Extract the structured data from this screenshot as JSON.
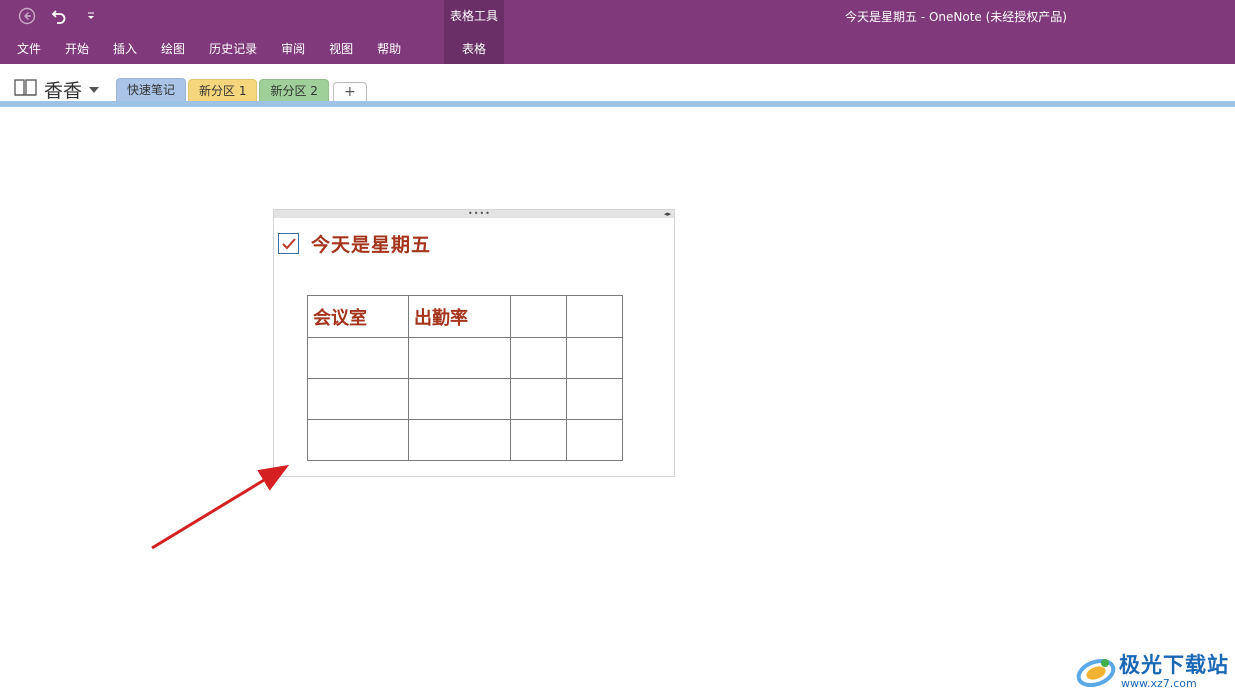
{
  "window": {
    "title": "今天是星期五  -  OneNote (未经授权产品)",
    "context_tab_group": "表格工具"
  },
  "quick_access": {
    "back_icon": "back-arrow-icon",
    "undo_icon": "undo-icon",
    "customize_icon": "customize-qat-icon"
  },
  "menu": {
    "items": [
      {
        "label": "文件"
      },
      {
        "label": "开始"
      },
      {
        "label": "插入"
      },
      {
        "label": "绘图"
      },
      {
        "label": "历史记录"
      },
      {
        "label": "审阅"
      },
      {
        "label": "视图"
      },
      {
        "label": "帮助"
      }
    ],
    "context_item": {
      "label": "表格"
    }
  },
  "notebook": {
    "name": "香香",
    "icon": "notebook-icon"
  },
  "sections": [
    {
      "label": "快速笔记",
      "color": "#a9c4e6",
      "active": true
    },
    {
      "label": "新分区 1",
      "color": "#f5d67c",
      "active": false
    },
    {
      "label": "新分区 2",
      "color": "#9fd09a",
      "active": false
    }
  ],
  "add_section_label": "+",
  "note": {
    "checked": true,
    "title": "今天是星期五",
    "table": {
      "rows": [
        [
          "会议室",
          "出勤率",
          "",
          ""
        ],
        [
          "",
          "",
          "",
          ""
        ],
        [
          "",
          "",
          "",
          ""
        ],
        [
          "",
          "",
          "",
          ""
        ]
      ]
    }
  },
  "watermark": {
    "text": "极光下载站",
    "url": "www.xz7.com"
  },
  "colors": {
    "ribbon": "#80397b",
    "context_group": "#6a2f66",
    "accent_text": "#a5341d",
    "page_strip": "#9dc3e6"
  }
}
